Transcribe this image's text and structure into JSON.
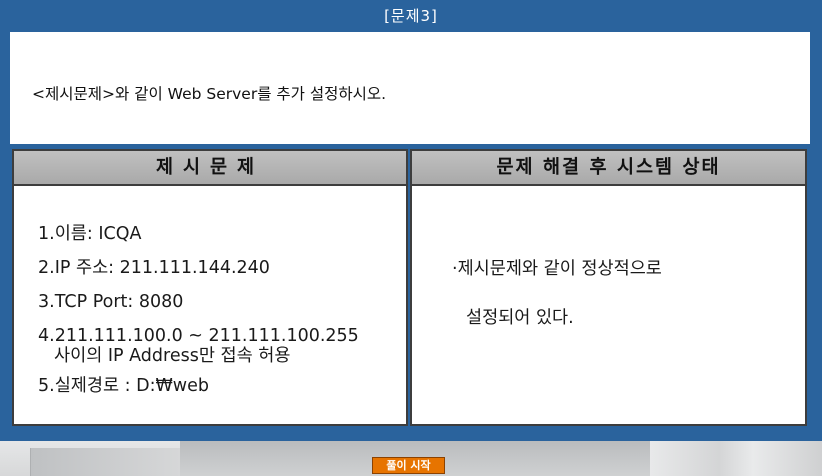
{
  "title": "[문제3]",
  "instruction": "<제시문제>와 같이 Web Server를 추가 설정하시오.",
  "left_panel": {
    "header": "제시문제",
    "items": [
      "1.이름: ICQA",
      "2.IP 주소: 211.111.144.240",
      "3.TCP Port: 8080",
      "4.211.111.100.0 ~ 211.111.100.255",
      "사이의 IP Address만 접속 허용",
      "5.실제경로 : D:₩web"
    ]
  },
  "right_panel": {
    "header": "문제 해결 후 시스템 상태",
    "line1": "·제시문제와 같이 정상적으로",
    "line2": "설정되어 있다."
  },
  "start_button_label": "풀이 시작",
  "colors": {
    "frame": "#2a639d",
    "panel_header": "#b3b3b3",
    "button": "#e77400"
  }
}
